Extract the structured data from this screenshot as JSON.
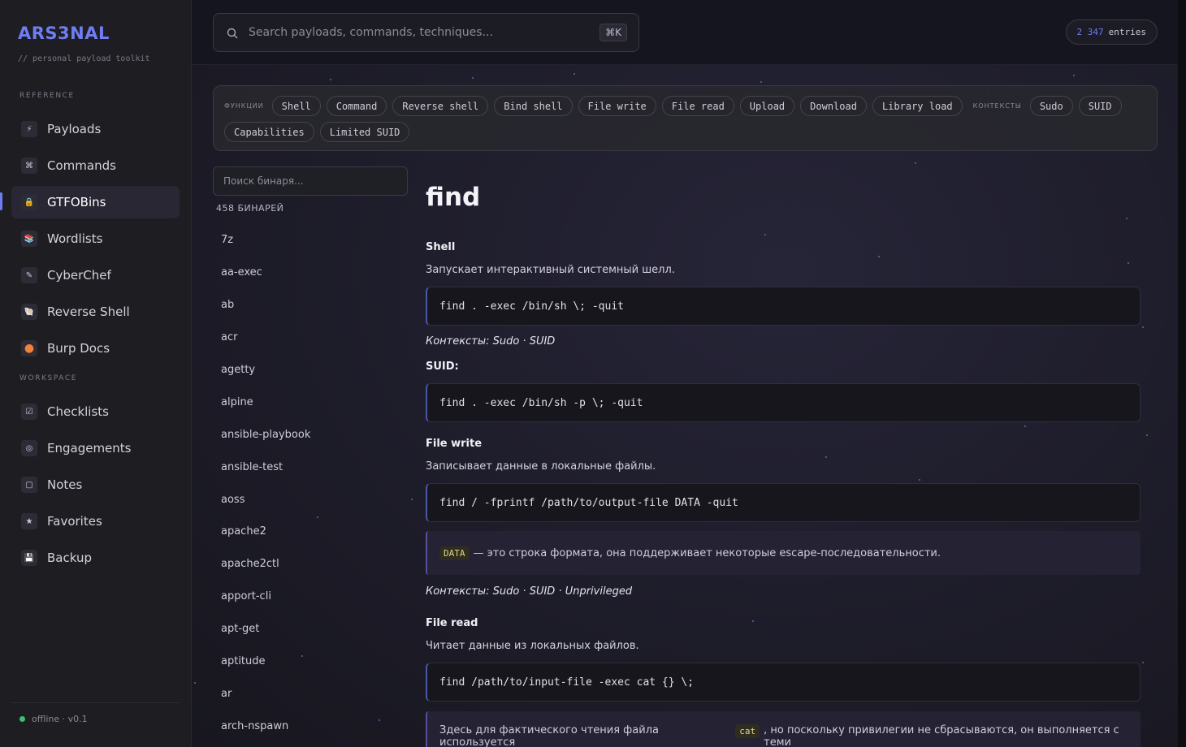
{
  "brand": {
    "title": "ARS3NAL",
    "subtitle": "// personal payload toolkit"
  },
  "sidebar": {
    "reference_label": "REFERENCE",
    "workspace_label": "WORKSPACE",
    "reference_items": [
      {
        "label": "Payloads",
        "icon": "lightning-icon",
        "glyph": "⚡"
      },
      {
        "label": "Commands",
        "icon": "command-icon",
        "glyph": "⌘"
      },
      {
        "label": "GTFOBins",
        "icon": "bottle-icon",
        "glyph": "🔒",
        "active": true
      },
      {
        "label": "Wordlists",
        "icon": "books-icon",
        "glyph": "📚"
      },
      {
        "label": "CyberChef",
        "icon": "pencil-icon",
        "glyph": "✎"
      },
      {
        "label": "Reverse Shell",
        "icon": "shell-icon",
        "glyph": "🐚"
      },
      {
        "label": "Burp Docs",
        "icon": "orange-circle-icon",
        "glyph": "●"
      }
    ],
    "workspace_items": [
      {
        "label": "Checklists",
        "icon": "checkbox-icon",
        "glyph": "☑"
      },
      {
        "label": "Engagements",
        "icon": "target-icon",
        "glyph": "◎"
      },
      {
        "label": "Notes",
        "icon": "note-icon",
        "glyph": "▢"
      },
      {
        "label": "Favorites",
        "icon": "star-icon",
        "glyph": "★"
      },
      {
        "label": "Backup",
        "icon": "floppy-icon",
        "glyph": "💾"
      }
    ],
    "status": "offline · v0.1"
  },
  "topbar": {
    "search_placeholder": "Search payloads, commands, techniques...",
    "shortcut": "⌘K",
    "entries_count": "2 347",
    "entries_label": "entries"
  },
  "filters": {
    "functions_label": "ФУНКЦИИ",
    "functions": [
      "Shell",
      "Command",
      "Reverse shell",
      "Bind shell",
      "File write",
      "File read",
      "Upload",
      "Download",
      "Library load"
    ],
    "contexts_label": "КОНТЕКСТЫ",
    "contexts": [
      "Sudo",
      "SUID",
      "Capabilities",
      "Limited SUID"
    ]
  },
  "binaries": {
    "search_placeholder": "Поиск бинаря...",
    "count_label": "458 БИНАРЕЙ",
    "items": [
      "7z",
      "aa-exec",
      "ab",
      "acr",
      "agetty",
      "alpine",
      "ansible-playbook",
      "ansible-test",
      "aoss",
      "apache2",
      "apache2ctl",
      "apport-cli",
      "apt-get",
      "aptitude",
      "ar",
      "arch-nspawn"
    ]
  },
  "detail": {
    "title": "find",
    "sections": [
      {
        "heading": "Shell",
        "desc": "Запускает интерактивный системный шелл.",
        "code": "find . -exec /bin/sh \\; -quit",
        "contexts": "Контексты: Sudo · SUID",
        "sub_heading": "SUID:",
        "sub_code": "find . -exec /bin/sh -p \\; -quit"
      },
      {
        "heading": "File write",
        "desc": "Записывает данные в локальные файлы.",
        "code": "find / -fprintf /path/to/output-file DATA -quit",
        "note_code": "DATA",
        "note_text": "— это строка формата, она поддерживает некоторые escape-последовательности.",
        "contexts": "Контексты: Sudo · SUID · Unprivileged"
      },
      {
        "heading": "File read",
        "desc": "Читает данные из локальных файлов.",
        "code": "find /path/to/input-file -exec cat {} \\;",
        "note_prefix": "Здесь для фактического чтения файла используется",
        "note_code": "cat",
        "note_text": ", но поскольку привилегии не сбрасываются, он выполняется с теми"
      }
    ]
  },
  "colors": {
    "accent": "#6f7cf2",
    "status_online": "#3cc26c",
    "background": "#1b1a24"
  }
}
